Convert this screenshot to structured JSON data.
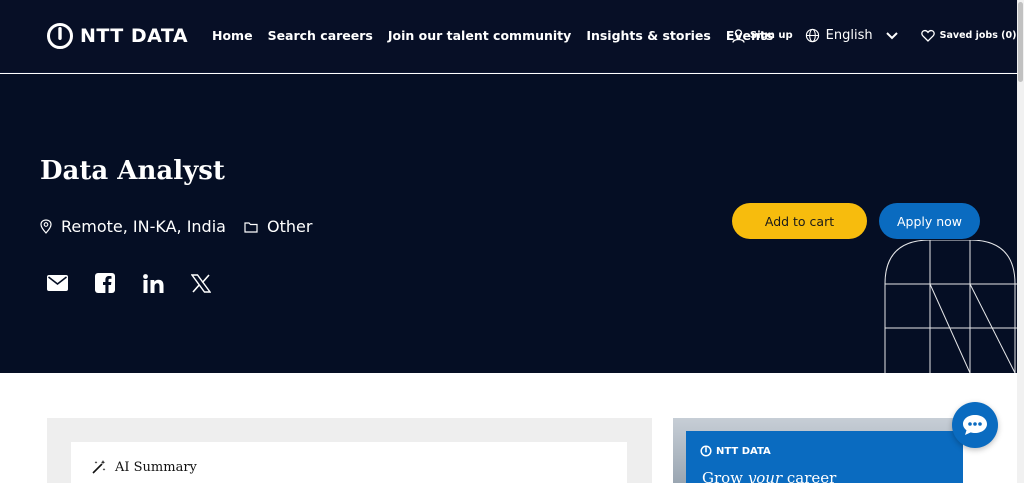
{
  "brand": {
    "logo_text": "NTT DATA"
  },
  "nav": {
    "links": [
      "Home",
      "Search careers",
      "Join our talent community",
      "Insights & stories",
      "Events"
    ],
    "sign_up": "Sign up",
    "language": "English",
    "saved_jobs": "Saved jobs (0)"
  },
  "job": {
    "title": "Data Analyst",
    "location": "Remote, IN-KA, India",
    "category": "Other",
    "add_to_cart": "Add to cart",
    "apply_now": "Apply now"
  },
  "share": {
    "icons": [
      "email-icon",
      "facebook-icon",
      "linkedin-icon",
      "x-icon"
    ]
  },
  "ai_summary": {
    "title": "AI Summary"
  },
  "promo": {
    "logo_text": "NTT DATA",
    "headline_prefix": "Grow ",
    "headline_emphasis": "your",
    "headline_suffix": " career"
  },
  "colors": {
    "nav_bg": "#070f26",
    "hero_bg": "#050e24",
    "cart": "#f7bc0d",
    "apply": "#0a6bc0"
  }
}
